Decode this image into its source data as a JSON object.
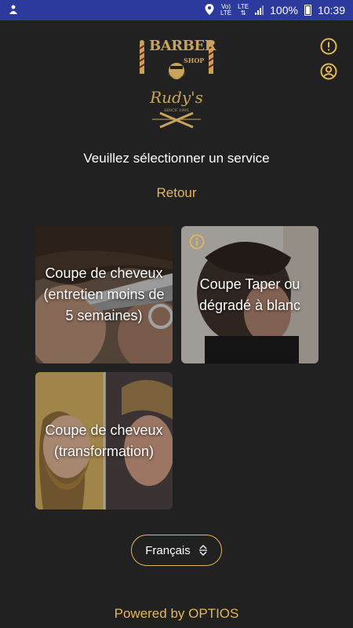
{
  "statusbar": {
    "volte_top": "Vo)",
    "volte_bottom": "LTE",
    "lte": "LTE",
    "battery": "100%",
    "time": "10:39"
  },
  "logo": {
    "line1": "BARBER",
    "line2": "SHOP",
    "script": "Rudy's",
    "since": "SINCE 1995"
  },
  "header": {
    "title": "Veuillez sélectionner un service",
    "back_label": "Retour"
  },
  "services": [
    {
      "label": "Coupe de cheveux (entretien moins de 5 semaines)"
    },
    {
      "label": "Coupe Taper ou dégradé à blanc"
    },
    {
      "label": "Coupe de cheveux (transformation)"
    }
  ],
  "language": {
    "selected": "Français"
  },
  "footer": {
    "powered": "Powered by OPTIOS"
  },
  "colors": {
    "accent": "#e3b757",
    "background": "#212121",
    "statusbar": "#2b3a9c"
  }
}
